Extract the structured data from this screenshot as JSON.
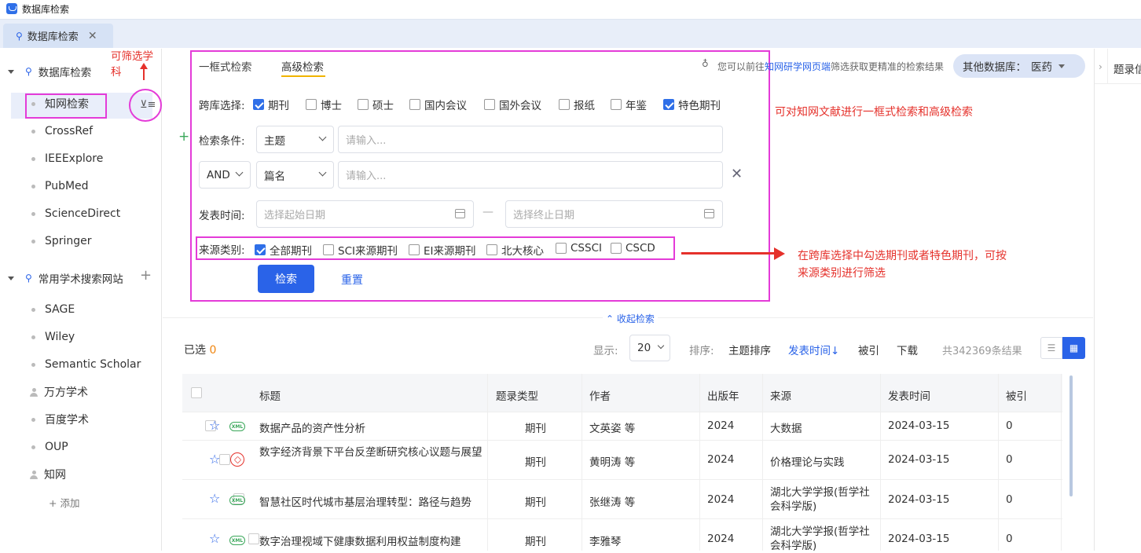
{
  "window": {
    "title": "数据库检索"
  },
  "tabs": [
    {
      "label": "数据库检索",
      "close": "✕"
    }
  ],
  "sidebar": {
    "group1": {
      "label": "数据库检索",
      "items": [
        "知网检索",
        "CrossRef",
        "IEEExplore",
        "PubMed",
        "ScienceDirect",
        "Springer"
      ]
    },
    "group2": {
      "label": "常用学术搜索网站",
      "add": "+",
      "items": [
        "SAGE",
        "Wiley",
        "Semantic Scholar",
        "万方学术",
        "百度学术",
        "OUP",
        "知网"
      ],
      "add_label": "+ 添加"
    }
  },
  "annotations": {
    "filter_subject": "可筛选学科",
    "search_modes": "可对知网文献进行一框式检索和高级检索",
    "source_filter_line1": "在跨库选择中勾选期刊或者特色期刊，可按",
    "source_filter_line2": "来源类别进行筛选"
  },
  "search": {
    "tab_simple": "一框式检索",
    "tab_advanced": "高级检索",
    "hint_prefix": "您可以前往",
    "hint_link": "知网研学网页端",
    "hint_suffix": "筛选获取更精准的检索结果",
    "other_db_label": "其他数据库：",
    "other_db_value": "医药",
    "cross_label": "跨库选择:",
    "cross_options": [
      {
        "label": "期刊",
        "checked": true
      },
      {
        "label": "博士",
        "checked": false
      },
      {
        "label": "硕士",
        "checked": false
      },
      {
        "label": "国内会议",
        "checked": false
      },
      {
        "label": "国外会议",
        "checked": false
      },
      {
        "label": "报纸",
        "checked": false
      },
      {
        "label": "年鉴",
        "checked": false
      },
      {
        "label": "特色期刊",
        "checked": true
      }
    ],
    "cond_label": "检索条件:",
    "field1": "主题",
    "input_placeholder": "请输入...",
    "logic": "AND",
    "field2": "篇名",
    "date_label": "发表时间:",
    "date_start": "选择起始日期",
    "date_sep": "—",
    "date_end": "选择终止日期",
    "source_label": "来源类别:",
    "source_options": [
      {
        "label": "全部期刊",
        "checked": true
      },
      {
        "label": "SCI来源期刊",
        "checked": false
      },
      {
        "label": "EI来源期刊",
        "checked": false
      },
      {
        "label": "北大核心",
        "checked": false
      },
      {
        "label": "CSSCI",
        "checked": false
      },
      {
        "label": "CSCD",
        "checked": false
      }
    ],
    "search_btn": "检索",
    "reset_btn": "重置",
    "collapse": "收起检索"
  },
  "results": {
    "selected_label": "已选",
    "selected_count": "0",
    "display_label": "显示:",
    "page_size": "20",
    "sort_label": "排序:",
    "sort_options": [
      "主题排序",
      "发表时间↓",
      "被引",
      "下载"
    ],
    "total": "共342369条结果",
    "headers": [
      "标题",
      "题录类型",
      "作者",
      "出版年",
      "来源",
      "发表时间",
      "被引"
    ],
    "rows": [
      {
        "title": "数据产品的资产性分析",
        "type": "期刊",
        "author": "文英姿 等",
        "year": "2024",
        "source": "大数据",
        "date": "2024-03-15",
        "cited": "0",
        "icon": "xml"
      },
      {
        "title": "数字经济背景下平台反垄断研究核心议题与展望",
        "title2": "望",
        "type": "期刊",
        "author": "黄明涛 等",
        "year": "2024",
        "source": "价格理论与实践",
        "date": "2024-03-15",
        "cited": "0",
        "icon": "pdf"
      },
      {
        "title": "智慧社区时代城市基层治理转型：路径与趋势",
        "type": "期刊",
        "author": "张继涛 等",
        "year": "2024",
        "source": "湖北大学学报(哲学社会科学版)",
        "date": "2024-03-15",
        "cited": "0",
        "icon": "xml"
      },
      {
        "title": "数字治理视域下健康数据利用权益制度构建",
        "type": "期刊",
        "author": "李雅琴",
        "year": "2024",
        "source": "湖北大学学报(哲学社会科学版)",
        "date": "2024-03-15",
        "cited": "0",
        "icon": "xml"
      }
    ]
  },
  "right_pane": {
    "label": "题录信"
  }
}
